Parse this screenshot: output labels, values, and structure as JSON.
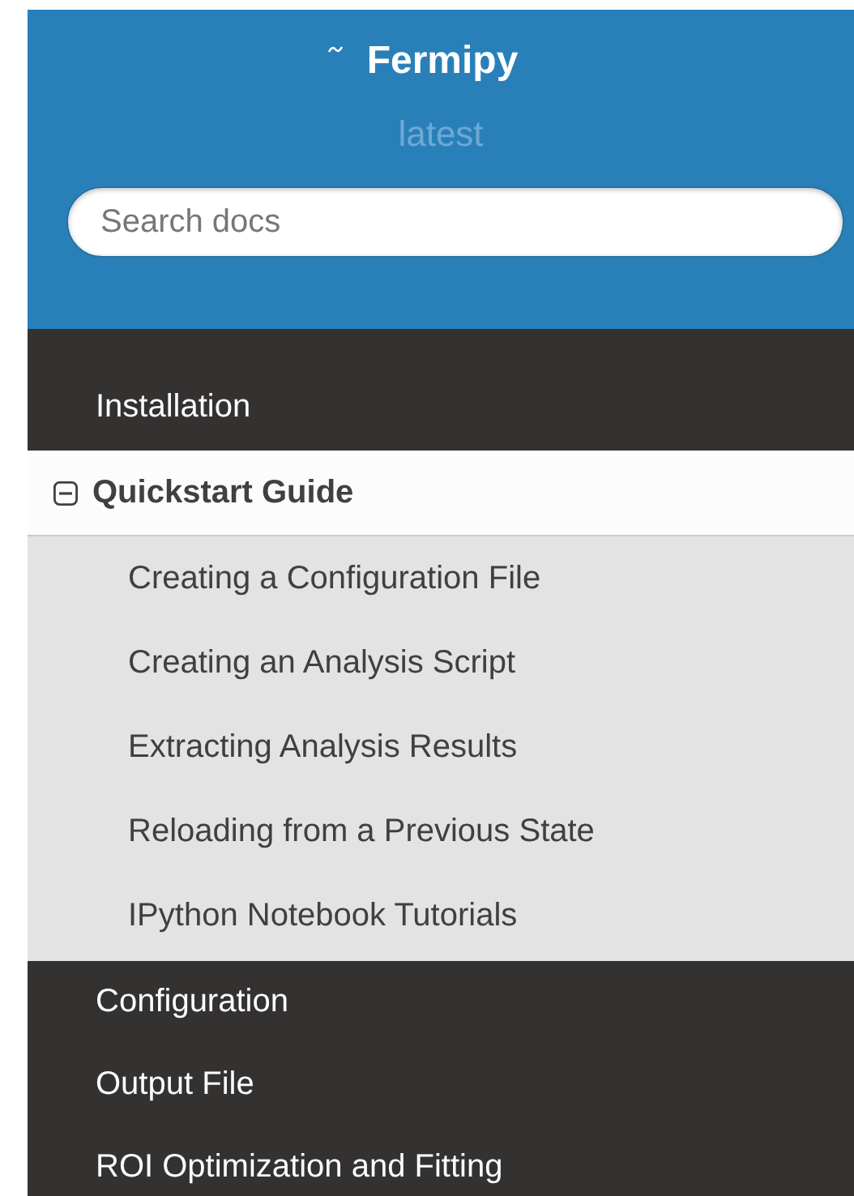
{
  "header": {
    "project": "Fermipy",
    "version": "latest",
    "search": {
      "placeholder": "Search docs"
    }
  },
  "nav": [
    {
      "label": "Installation",
      "selected": false,
      "expanded": false
    },
    {
      "label": "Quickstart Guide",
      "selected": true,
      "expanded": true,
      "children": [
        {
          "label": "Creating a Configuration File"
        },
        {
          "label": "Creating an Analysis Script"
        },
        {
          "label": "Extracting Analysis Results"
        },
        {
          "label": "Reloading from a Previous State"
        },
        {
          "label": "IPython Notebook Tutorials"
        }
      ]
    },
    {
      "label": "Configuration",
      "selected": false,
      "expanded": false
    },
    {
      "label": "Output File",
      "selected": false,
      "expanded": false
    },
    {
      "label": "ROI Optimization and Fitting",
      "selected": false,
      "expanded": false
    }
  ]
}
